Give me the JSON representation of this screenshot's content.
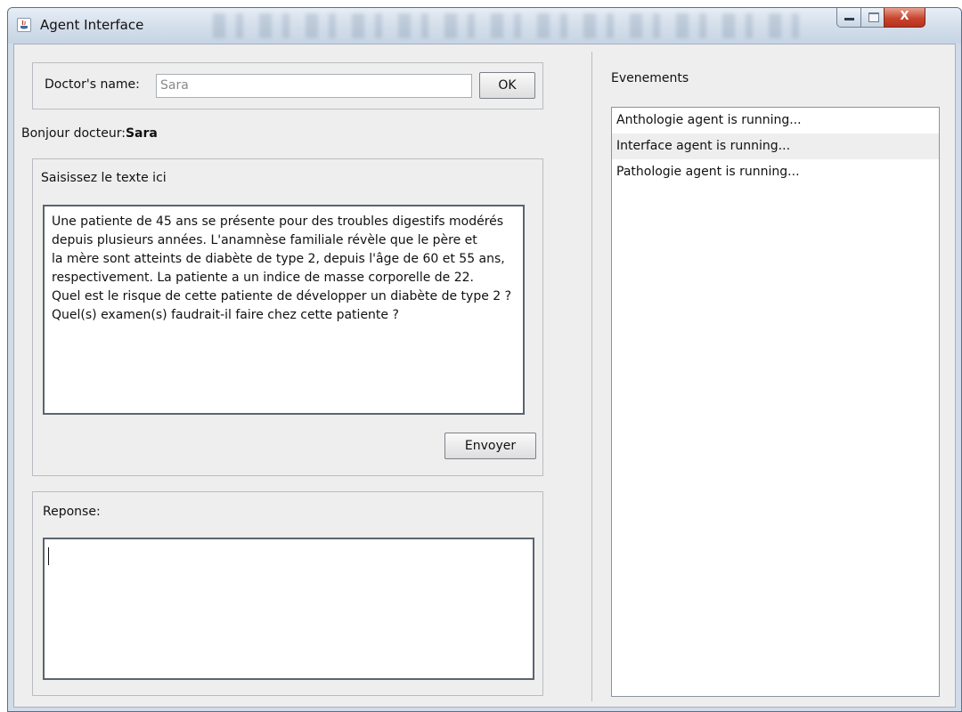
{
  "window": {
    "title": "Agent Interface",
    "close_glyph": "X"
  },
  "doctor": {
    "label": "Doctor's name:",
    "value": "Sara",
    "ok_label": "OK"
  },
  "greeting": {
    "prefix": "Bonjour docteur:",
    "name": "Sara"
  },
  "input_panel": {
    "label": "Saisissez le texte ici",
    "text": "Une patiente de 45 ans se présente pour des troubles digestifs modérés\ndepuis plusieurs années. L'anamnèse familiale révèle que le père et\nla mère sont atteints de diabète de type 2, depuis l'âge de 60 et 55 ans,\nrespectivement. La patiente a un indice de masse corporelle de 22.\nQuel est le risque de cette patiente de développer un diabète de type 2 ?\nQuel(s) examen(s) faudrait-il faire chez cette patiente ?",
    "send_label": "Envoyer"
  },
  "response_panel": {
    "label": "Reponse:",
    "text": ""
  },
  "events": {
    "label": "Evenements",
    "items": [
      "Anthologie agent is running...",
      "Interface agent is running...",
      "Pathologie agent is running..."
    ]
  }
}
